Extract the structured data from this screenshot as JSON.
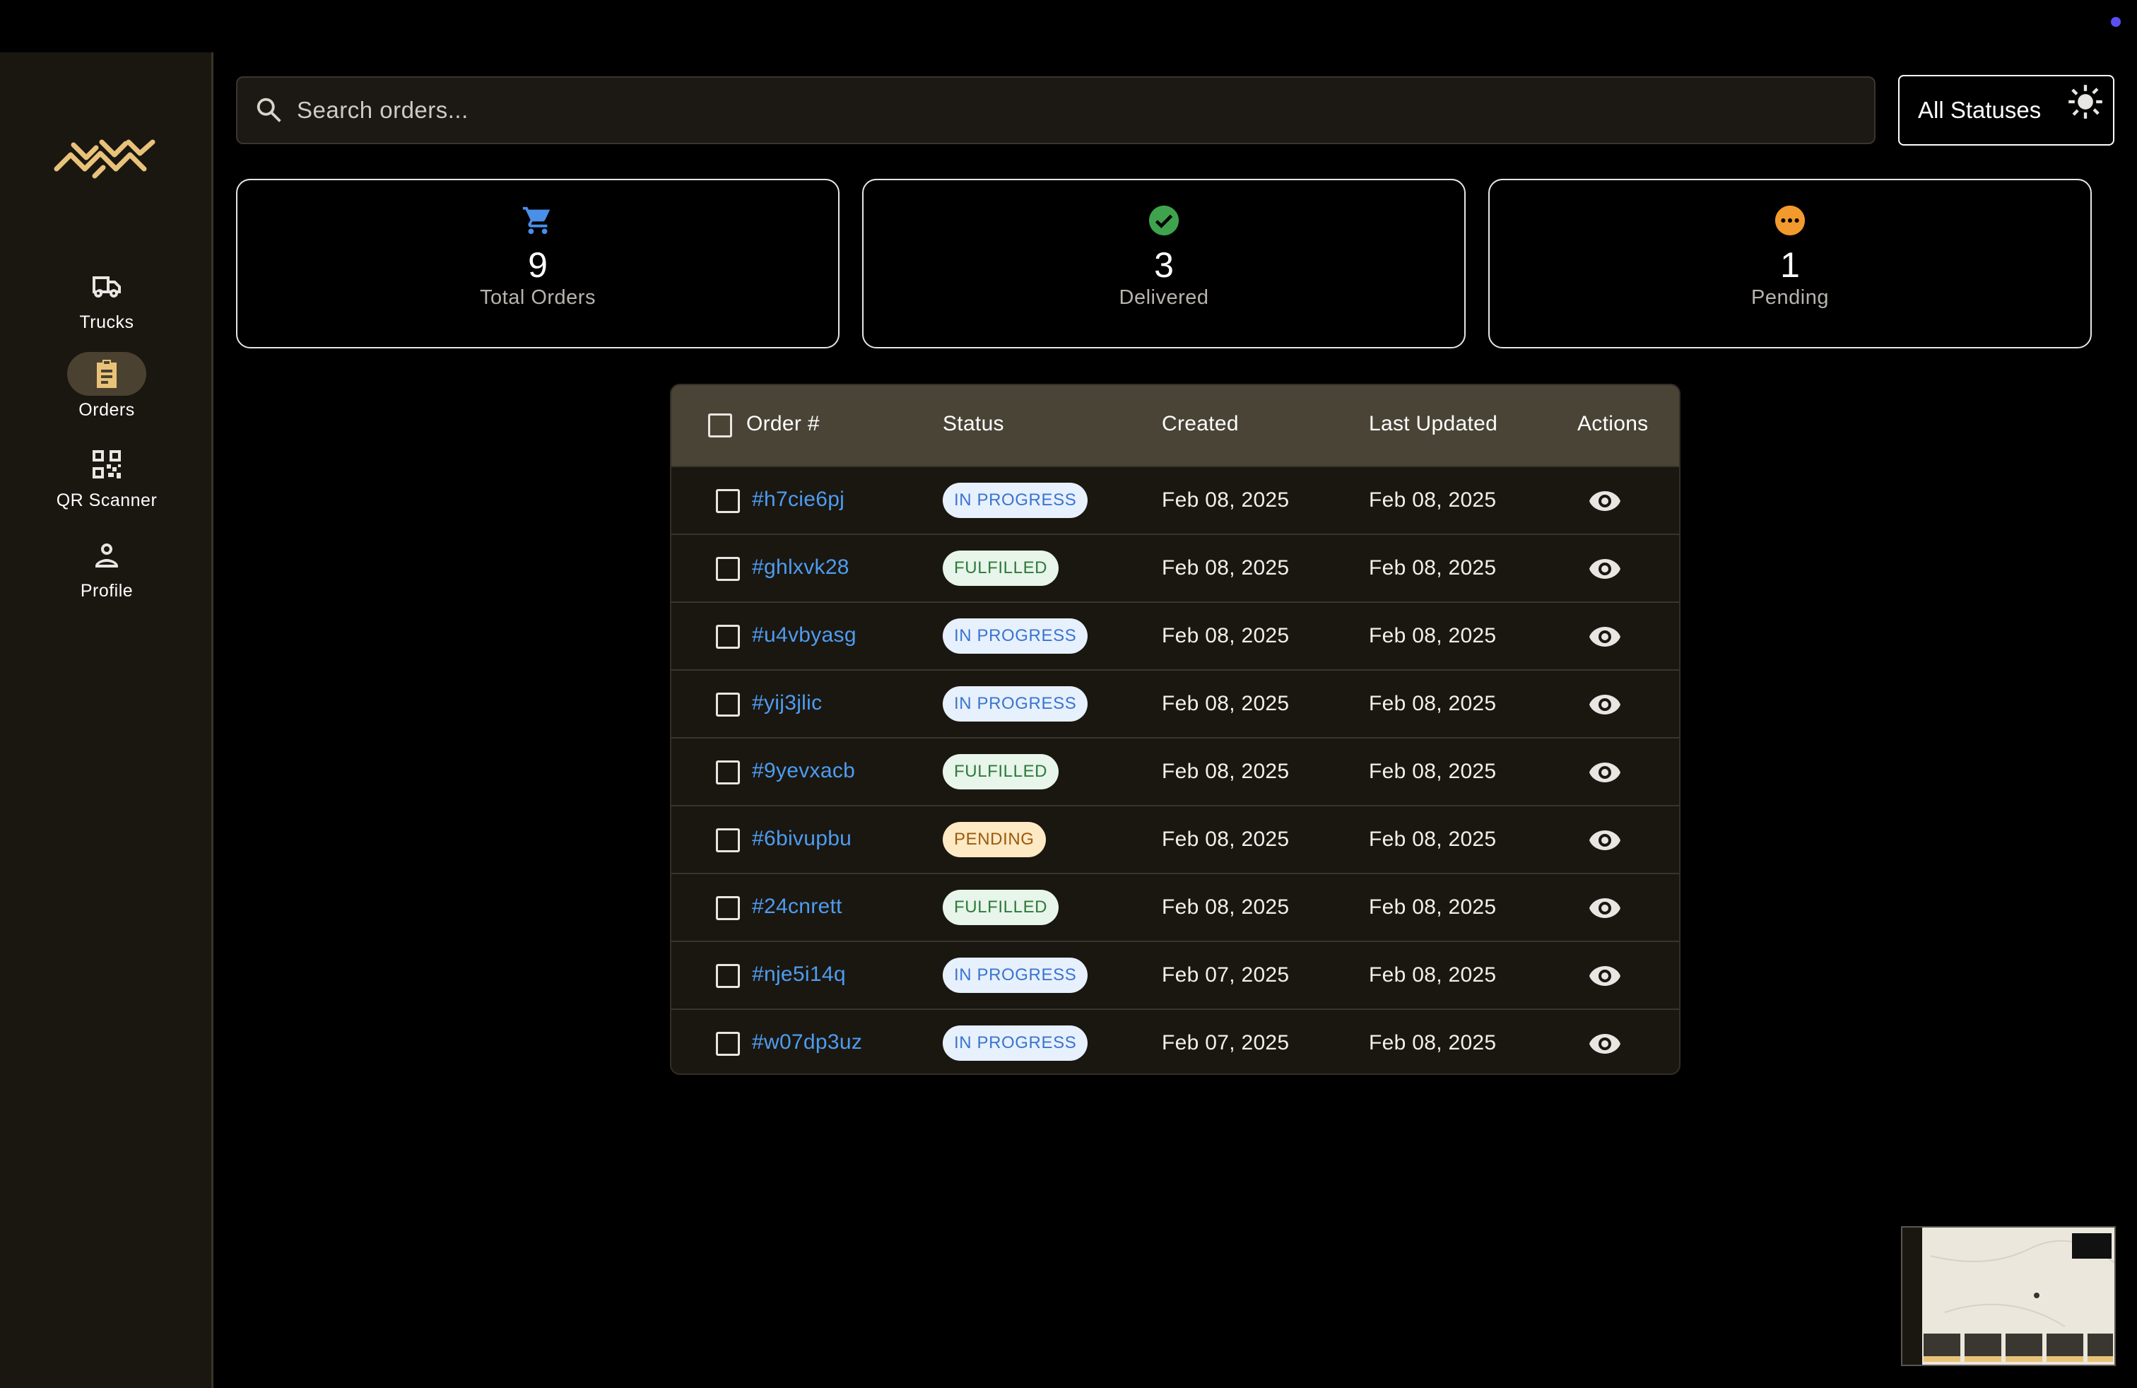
{
  "sidebar": {
    "items": [
      {
        "label": "Trucks",
        "icon": "truck-icon",
        "active": false
      },
      {
        "label": "Orders",
        "icon": "clipboard-icon",
        "active": true
      },
      {
        "label": "QR Scanner",
        "icon": "qr-code-icon",
        "active": false
      },
      {
        "label": "Profile",
        "icon": "person-icon",
        "active": false
      }
    ]
  },
  "search": {
    "placeholder": "Search orders..."
  },
  "filter": {
    "selected": "All Statuses"
  },
  "stats": [
    {
      "value": "9",
      "label": "Total Orders",
      "icon": "cart-icon",
      "color": "#4a8fe8"
    },
    {
      "value": "3",
      "label": "Delivered",
      "icon": "check-circle-icon",
      "color": "#3fa34d"
    },
    {
      "value": "1",
      "label": "Pending",
      "icon": "more-circle-icon",
      "color": "#f39a2e"
    }
  ],
  "table": {
    "headers": {
      "order": "Order #",
      "status": "Status",
      "created": "Created",
      "updated": "Last Updated",
      "actions": "Actions"
    },
    "rows": [
      {
        "id": "#h7cie6pj",
        "status": "IN PROGRESS",
        "created": "Feb 08, 2025",
        "updated": "Feb 08, 2025"
      },
      {
        "id": "#ghlxvk28",
        "status": "FULFILLED",
        "created": "Feb 08, 2025",
        "updated": "Feb 08, 2025"
      },
      {
        "id": "#u4vbyasg",
        "status": "IN PROGRESS",
        "created": "Feb 08, 2025",
        "updated": "Feb 08, 2025"
      },
      {
        "id": "#yij3jlic",
        "status": "IN PROGRESS",
        "created": "Feb 08, 2025",
        "updated": "Feb 08, 2025"
      },
      {
        "id": "#9yevxacb",
        "status": "FULFILLED",
        "created": "Feb 08, 2025",
        "updated": "Feb 08, 2025"
      },
      {
        "id": "#6bivupbu",
        "status": "PENDING",
        "created": "Feb 08, 2025",
        "updated": "Feb 08, 2025"
      },
      {
        "id": "#24cnrett",
        "status": "FULFILLED",
        "created": "Feb 08, 2025",
        "updated": "Feb 08, 2025"
      },
      {
        "id": "#nje5i14q",
        "status": "IN PROGRESS",
        "created": "Feb 07, 2025",
        "updated": "Feb 08, 2025"
      },
      {
        "id": "#w07dp3uz",
        "status": "IN PROGRESS",
        "created": "Feb 07, 2025",
        "updated": "Feb 08, 2025"
      }
    ]
  },
  "colors": {
    "accent_gold": "#e9c27a",
    "link_blue": "#4e9cf0",
    "sidebar_bg": "#1a1711",
    "header_bg": "#4a4437"
  }
}
